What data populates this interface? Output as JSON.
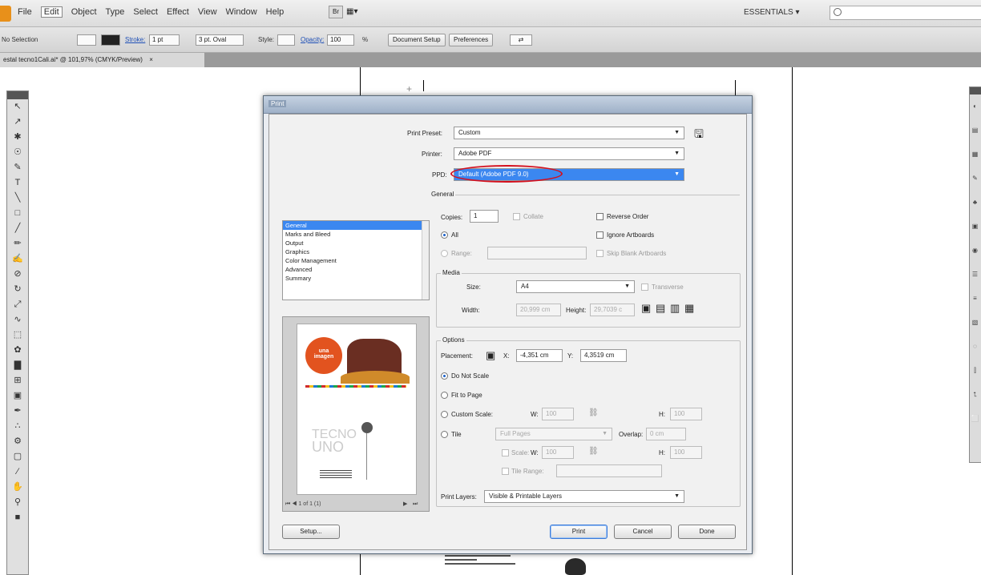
{
  "menubar": {
    "items": [
      "File",
      "Edit",
      "Object",
      "Type",
      "Select",
      "Effect",
      "View",
      "Window",
      "Help"
    ],
    "workspace": "ESSENTIALS ▾"
  },
  "control": {
    "selection": "No Selection",
    "stroke_label": "Stroke:",
    "stroke_value": "1 pt",
    "brush": "3 pt. Oval",
    "style_label": "Style:",
    "opacity_label": "Opacity:",
    "opacity_value": "100",
    "opacity_unit": "%",
    "doc_setup": "Document Setup",
    "preferences": "Preferences"
  },
  "doc_tab": {
    "title": "estal tecno1Cali.ai* @ 101,97% (CMYK/Preview)",
    "close": "×"
  },
  "print": {
    "title": "Print",
    "preset_label": "Print Preset:",
    "preset_value": "Custom",
    "printer_label": "Printer:",
    "printer_value": "Adobe PDF",
    "ppd_label": "PPD:",
    "ppd_value": "Default (Adobe PDF 9.0)",
    "categories": [
      "General",
      "Marks and Bleed",
      "Output",
      "Graphics",
      "Color Management",
      "Advanced",
      "Summary"
    ],
    "general_title": "General",
    "copies_label": "Copies:",
    "copies_value": "1",
    "collate": "Collate",
    "reverse_order": "Reverse Order",
    "all": "All",
    "ignore_artboards": "Ignore Artboards",
    "range": "Range:",
    "skip_blank": "Skip Blank Artboards",
    "media_title": "Media",
    "size_label": "Size:",
    "size_value": "A4",
    "transverse": "Transverse",
    "width_label": "Width:",
    "width_value": "20,999 cm",
    "height_label": "Height:",
    "height_value": "29,7039 c",
    "options_title": "Options",
    "placement_label": "Placement:",
    "x_label": "X:",
    "x_value": "-4,351 cm",
    "y_label": "Y:",
    "y_value": "4,3519 cm",
    "do_not_scale": "Do Not Scale",
    "fit_to_page": "Fit to Page",
    "custom_scale": "Custom Scale:",
    "w_label": "W:",
    "w_value": "100",
    "h_label": "H:",
    "h_value": "100",
    "tile": "Tile",
    "tile_value": "Full Pages",
    "overlap_label": "Overlap:",
    "overlap_value": "0 cm",
    "scale_label": "Scale:",
    "tile_range": "Tile Range:",
    "print_layers_label": "Print Layers:",
    "print_layers_value": "Visible & Printable Layers",
    "page_nav": "1 of 1 (1)",
    "setup_btn": "Setup...",
    "print_btn": "Print",
    "cancel_btn": "Cancel",
    "done_btn": "Done"
  },
  "poster": {
    "headline": "una imagen",
    "tecno": "TECNO",
    "uno": "UNO"
  },
  "colors": {
    "accent": "#3b87f0",
    "highlight_oval": "#d4101e",
    "poster_orange": "#e2531f",
    "poster_brown": "#5a2a1e"
  }
}
